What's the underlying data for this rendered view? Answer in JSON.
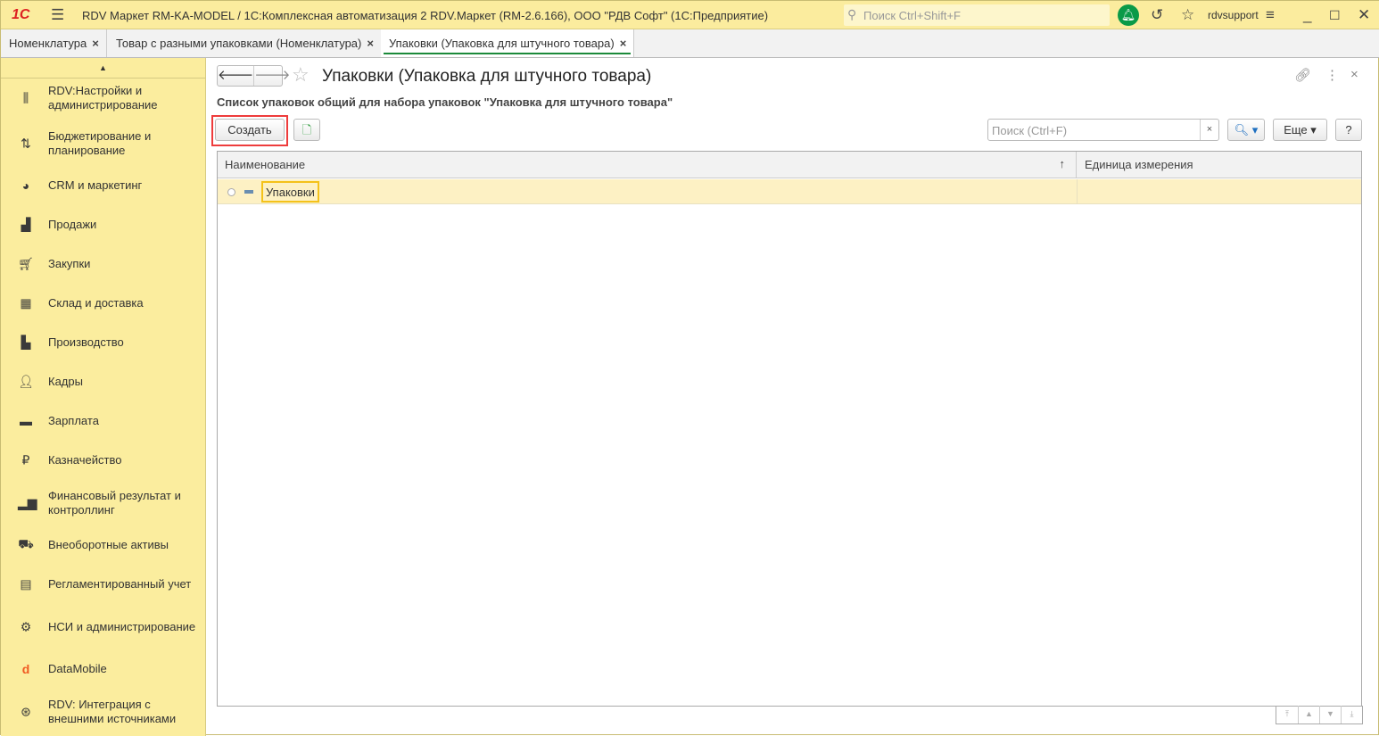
{
  "titlebar": {
    "logo": "1С",
    "title": "RDV Маркет RM-KA-MODEL / 1С:Комплексная автоматизация 2 RDV.Маркет (RM-2.6.166), ООО \"РДВ Софт\"  (1С:Предприятие)",
    "search_placeholder": "Поиск Ctrl+Shift+F",
    "user": "rdvsupport"
  },
  "tabs": [
    {
      "label": "Номенклатура",
      "close": "×"
    },
    {
      "label": "Товар с разными упаковками (Номенклатура)",
      "close": "×"
    },
    {
      "label": "Упаковки (Упаковка для штучного товара)",
      "close": "×"
    }
  ],
  "sidebar": {
    "items": [
      {
        "label": "RDV:Настройки и администрирование"
      },
      {
        "label": "Бюджетирование и планирование"
      },
      {
        "label": "CRM и маркетинг"
      },
      {
        "label": "Продажи"
      },
      {
        "label": "Закупки"
      },
      {
        "label": "Склад и доставка"
      },
      {
        "label": "Производство"
      },
      {
        "label": "Кадры"
      },
      {
        "label": "Зарплата"
      },
      {
        "label": "Казначейство"
      },
      {
        "label": "Финансовый результат и контроллинг"
      },
      {
        "label": "Внеоборотные активы"
      },
      {
        "label": "Регламентированный учет"
      },
      {
        "label": "НСИ и администрирование"
      },
      {
        "label": "DataMobile"
      },
      {
        "label": "RDV: Интеграция с внешними источниками"
      }
    ]
  },
  "form": {
    "title": "Упаковки (Упаковка для штучного товара)",
    "subtitle": "Список упаковок общий для набора упаковок \"Упаковка для штучного товара\"",
    "create_label": "Создать",
    "search_placeholder": "Поиск (Ctrl+F)",
    "search_clear": "×",
    "more_label": "Еще ▾",
    "help_label": "?",
    "columns": [
      {
        "label": "Наименование",
        "sort": "↑"
      },
      {
        "label": "Единица измерения"
      }
    ],
    "rows": [
      {
        "name": "Упаковки",
        "unit": ""
      }
    ]
  }
}
